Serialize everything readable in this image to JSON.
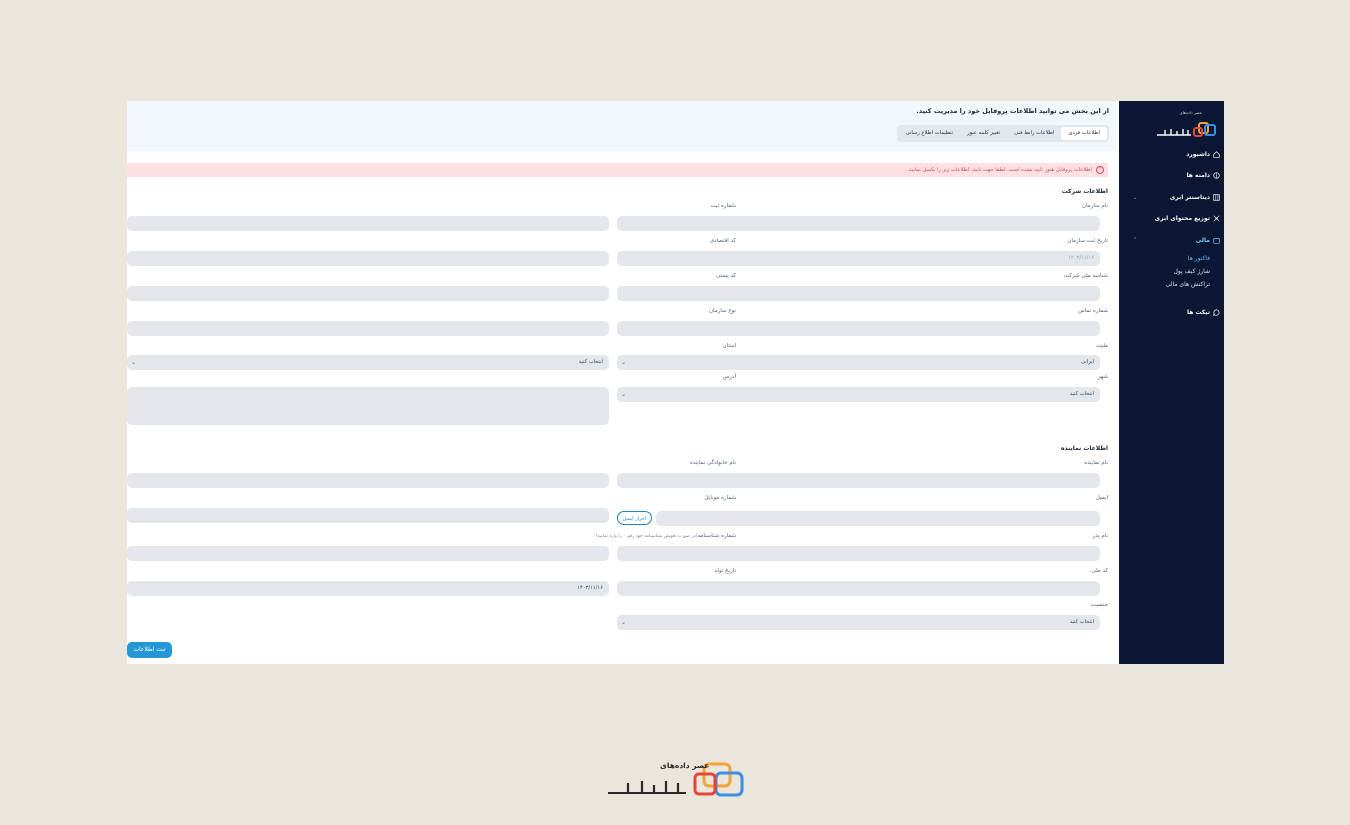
{
  "header": {
    "intro": "از این بخش می توانید اطلاعات پروفایل خود را مدیریت کنید.",
    "tabs": [
      "اطلاعات فردی",
      "اطلاعات رابط فنی",
      "تغییر کلمه عبور",
      "تنظیمات اطلاع رسانی"
    ]
  },
  "alert": "اطلاعات پروفایل هنوز تایید نشده است. لطفا جهت تایید، اطلاعات زیر را تکمیل نمایید.",
  "company": {
    "title": "اطلاعات شرکت",
    "org_name_label": "نام سازمان",
    "reg_number_label": "شماره ثبت",
    "org_reg_date_label": "تاریخ ثبت سازمان",
    "org_reg_date_placeholder": "۱۴۰۳/۱۱/۱۶",
    "economic_code_label": "کد اقتصادی",
    "national_id_label": "شناسه ملی شرکت",
    "postal_code_label": "کد پستی",
    "phone_label": "شماره تماس",
    "org_type_label": "نوع سازمان",
    "nationality_label": "ملیت",
    "nationality_value": "ایرانی",
    "province_label": "استان",
    "province_value": "انتخاب کنید",
    "city_label": "شهر",
    "city_value": "انتخاب کنید",
    "address_label": "آدرس"
  },
  "representative": {
    "title": "اطلاعات نماینده",
    "name_label": "نام نماینده",
    "family_label": "نام خانوادگی نماینده",
    "email_label": "ایمیل",
    "verify_email": "احراز ایمیل",
    "mobile_label": "شماره موبایل",
    "father_label": "نام پدر",
    "id_number_label": "شماره شناسنامه",
    "id_number_hint": "(در صورت تعویض شناسنامه خود رقم ۰ را وارد نمایید)",
    "national_code_label": "کد ملی",
    "birth_label": "تاریخ تولد",
    "birth_value": "۱۴۰۳/۱۱/۱۶",
    "gender_label": "جنسیت",
    "gender_value": "انتخاب کنید"
  },
  "submit": "ثبت اطلاعات",
  "sidebar": {
    "logo_tagline": "عصر داده‌های",
    "logo_text": "آسیاتک",
    "items": [
      {
        "label": "داشبورد",
        "icon": "home-icon"
      },
      {
        "label": "دامنه ها",
        "icon": "globe-icon"
      },
      {
        "label": "دیتاسنتر ابری",
        "icon": "server-icon"
      },
      {
        "label": "توزیع محتوای ابری",
        "icon": "network-icon"
      },
      {
        "label": "مالی",
        "icon": "wallet-icon"
      },
      {
        "label": "تیکت ها",
        "icon": "chat-icon"
      }
    ],
    "finance_sub": [
      "فاکتور ها",
      "شارژ کیف پول",
      "تراکنش های مالی"
    ]
  },
  "footer_logo": {
    "tagline": "عصر داده‌های",
    "text": "آسیاتک"
  },
  "colors": {
    "sidebar": "#0b1733",
    "accent": "#2497d6",
    "alert_bg": "#fde0e2",
    "alert_text": "#d04a55",
    "page_bg": "#eae6dc"
  }
}
